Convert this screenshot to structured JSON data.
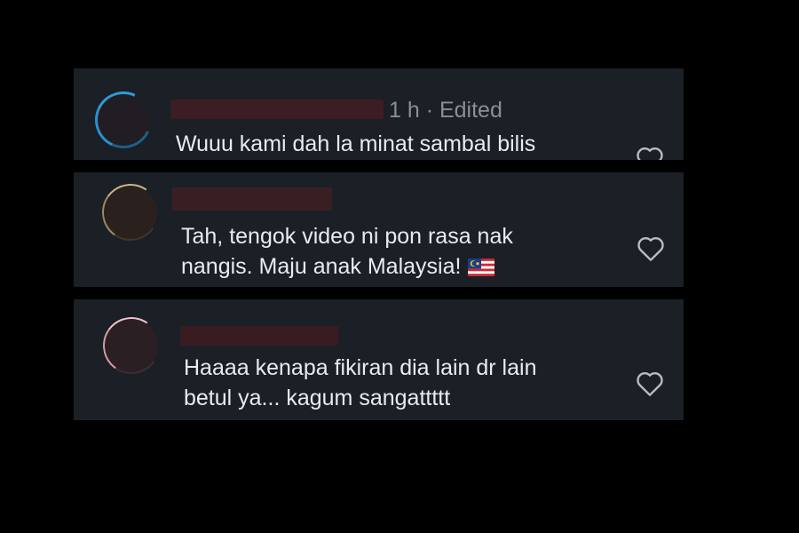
{
  "comments": [
    {
      "meta": "1 h · Edited",
      "text_lines": [
        "Wuuu kami dah la minat sambal bilis"
      ],
      "like_icon": "heart-outline-icon"
    },
    {
      "meta": "",
      "text_lines": [
        "Tah, tengok video ni pon rasa nak",
        "nangis. Maju anak Malaysia!"
      ],
      "emoji": "malaysia-flag-icon",
      "like_icon": "heart-outline-icon"
    },
    {
      "meta": "",
      "text_lines": [
        "Haaaa kenapa fikiran dia lain dr lain",
        "betul ya... kagum sangattttt"
      ],
      "like_icon": "heart-outline-icon"
    }
  ],
  "colors": {
    "page_background": "#000000",
    "card_background": "#1b1f26",
    "comment_text": "#e9ebee",
    "meta_text": "#8a8e96",
    "heart_outline": "#b9bcc2"
  }
}
